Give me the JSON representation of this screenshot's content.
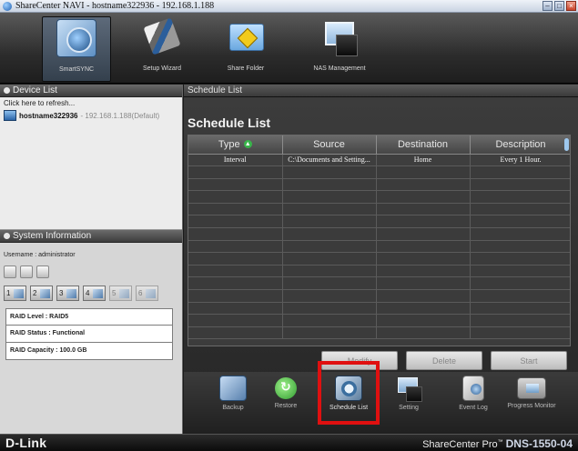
{
  "window": {
    "title": "ShareCenter NAVI - hostname322936 - 192.168.1.188",
    "controls": [
      "minimize",
      "maximize",
      "close"
    ]
  },
  "topnav": {
    "items": [
      {
        "label": "SmartSYNC",
        "icon": "smartsync-icon",
        "active": true
      },
      {
        "label": "Setup Wizard",
        "icon": "setup-wizard-icon",
        "active": false
      },
      {
        "label": "Share Folder",
        "icon": "share-folder-icon",
        "active": false
      },
      {
        "label": "NAS Management",
        "icon": "nas-management-icon",
        "active": false
      }
    ]
  },
  "device_list": {
    "header": "Device List",
    "refresh": "Click here to refresh...",
    "device": {
      "name": "hostname322936",
      "ip": "- 192.168.1.188(Default)"
    }
  },
  "system_info": {
    "header": "System Information",
    "username": "Username : administrator",
    "small_icons": [
      "fan-icon",
      "thermometer-icon",
      "gauge-icon"
    ],
    "disks": [
      {
        "label": "1",
        "active": true
      },
      {
        "label": "2",
        "active": true
      },
      {
        "label": "3",
        "active": true
      },
      {
        "label": "4",
        "active": true
      },
      {
        "label": "5",
        "active": false
      },
      {
        "label": "6",
        "active": false
      }
    ],
    "raid_level": "RAID Level : RAID5",
    "raid_status": "RAID Status : Functional",
    "raid_capacity": "RAID Capacity : 100.0 GB"
  },
  "main": {
    "header": "Schedule List",
    "title": "Schedule List",
    "columns": [
      "Type",
      "Source",
      "Destination",
      "Description"
    ],
    "rows": [
      [
        "Interval",
        "C:\\Documents and Setting...",
        "Home",
        "Every 1 Hour."
      ]
    ],
    "buttons": {
      "modify": "Modify",
      "delete": "Delete",
      "start": "Start"
    }
  },
  "bottomnav": {
    "items": [
      {
        "label": "Backup",
        "icon": "backup-icon"
      },
      {
        "label": "Restore",
        "icon": "restore-icon"
      },
      {
        "label": "Schedule List",
        "icon": "schedule-list-icon",
        "selected": true
      },
      {
        "label": "Setting",
        "icon": "setting-icon"
      },
      {
        "label": "Event Log",
        "icon": "event-log-icon"
      },
      {
        "label": "Progress Monitor",
        "icon": "progress-monitor-icon"
      }
    ]
  },
  "footer": {
    "brand": "D-Link",
    "product": "ShareCenter Pro",
    "trademark": "™",
    "model": "DNS-1550-04"
  },
  "colors": {
    "highlight": "#e01010",
    "accent": "#38b54a",
    "panel_dark": "#2c2c2c"
  }
}
